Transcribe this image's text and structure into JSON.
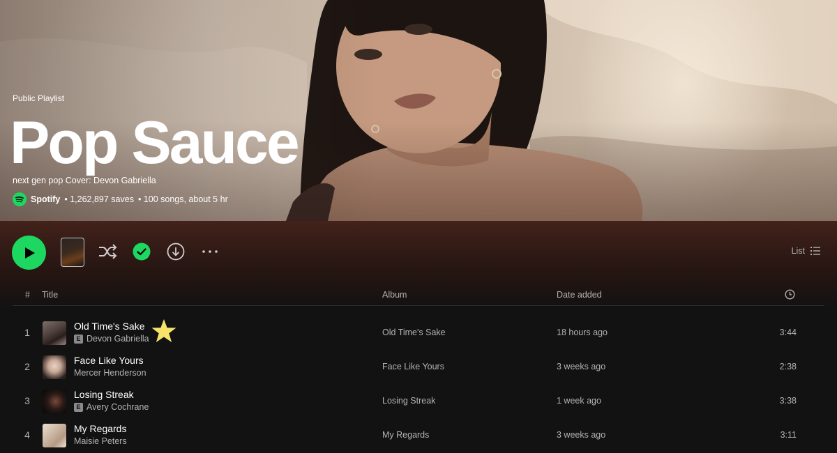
{
  "header": {
    "type_label": "Public Playlist",
    "title": "Pop Sauce",
    "description": "next gen pop Cover: Devon Gabriella",
    "owner": "Spotify",
    "saves": "• 1,262,897 saves",
    "stats": "• 100 songs, about 5 hr"
  },
  "actions": {
    "play_icon": "play-icon",
    "shuffle_icon": "shuffle-icon",
    "saved_icon": "check-circle-icon",
    "download_icon": "download-icon",
    "more_icon": "more-icon",
    "view_label": "List",
    "accent": "#1ed760"
  },
  "table": {
    "headers": {
      "num": "#",
      "title": "Title",
      "album": "Album",
      "date_added": "Date added",
      "duration_icon": "clock-icon"
    },
    "rows": [
      {
        "num": "1",
        "title": "Old Time's Sake",
        "explicit": "E",
        "artist": "Devon Gabriella",
        "album": "Old Time's Sake",
        "added": "18 hours ago",
        "duration": "3:44"
      },
      {
        "num": "2",
        "title": "Face Like Yours",
        "artist": "Mercer Henderson",
        "album": "Face Like Yours",
        "added": "3 weeks ago",
        "duration": "2:38"
      },
      {
        "num": "3",
        "title": "Losing Streak",
        "explicit": "E",
        "artist": "Avery Cochrane",
        "album": "Losing Streak",
        "added": "1 week ago",
        "duration": "3:38"
      },
      {
        "num": "4",
        "title": "My Regards",
        "artist": "Maisie Peters",
        "album": "My Regards",
        "added": "3 weeks ago",
        "duration": "3:11"
      }
    ]
  },
  "annotation": {
    "star_color": "#f7e36a"
  }
}
